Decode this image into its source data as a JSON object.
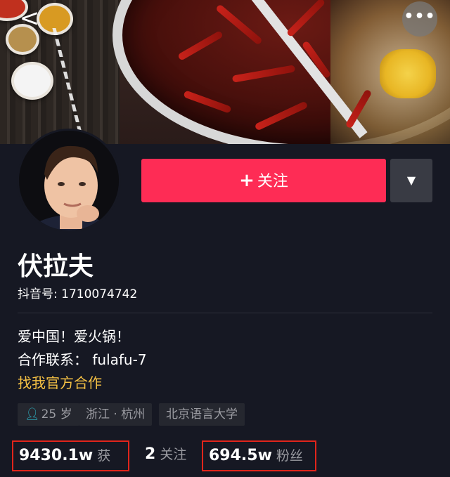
{
  "header": {
    "back_icon": "<",
    "more_icon": "•••"
  },
  "profile": {
    "name": "伏拉夫",
    "douyin_id": "抖音号: 1710074742",
    "follow_label": "关注",
    "follow_plus": "+",
    "dropdown_icon": "▼"
  },
  "bio": {
    "line1": "爱中国！爱火锅！",
    "line2": "合作联系：  fulafu-7",
    "link": "找我官方合作"
  },
  "tags": {
    "age": "25 岁",
    "location": "浙江 · 杭州",
    "school": "北京语言大学"
  },
  "stats": {
    "likes_num": "9430.1w",
    "likes_label": "获赞",
    "following_num": "2",
    "following_label": "关注",
    "fans_num": "694.5w",
    "fans_label": "粉丝"
  },
  "colors": {
    "follow": "#fe2c55",
    "link": "#f5c144",
    "background": "#161823",
    "highlight_box": "#e1251b"
  }
}
